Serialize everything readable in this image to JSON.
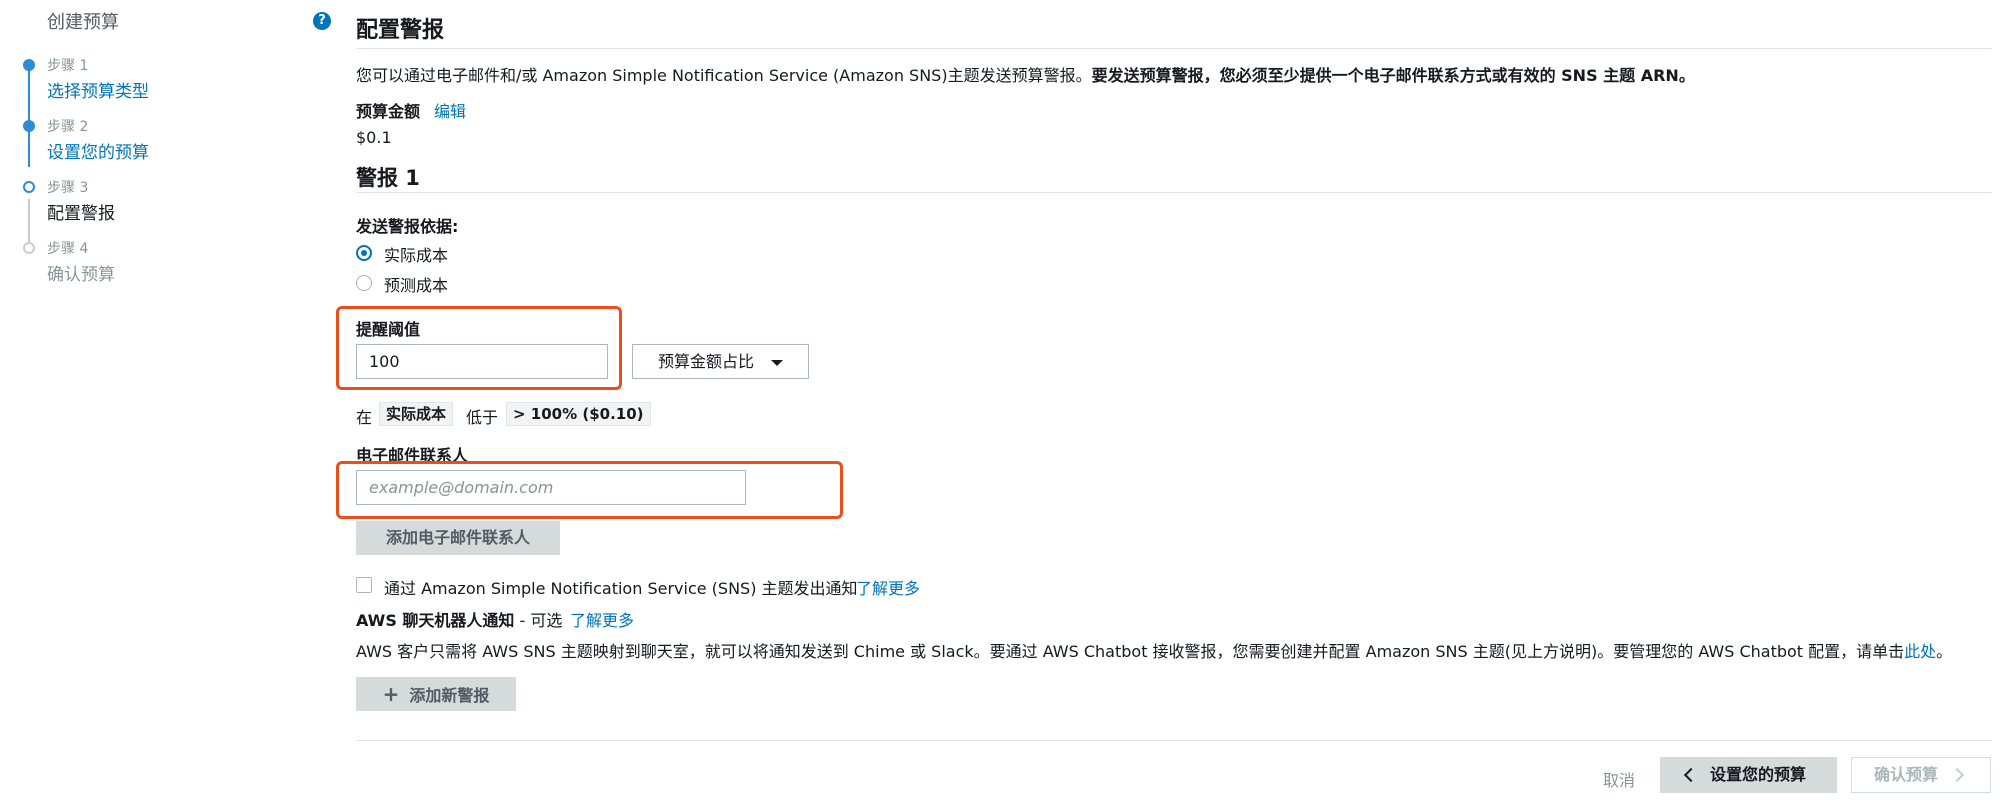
{
  "sidebar": {
    "title": "创建预算",
    "help_icon": "question-circle-icon",
    "steps": [
      {
        "num": "步骤 1",
        "label": "选择预算类型"
      },
      {
        "num": "步骤 2",
        "label": "设置您的预算"
      },
      {
        "num": "步骤 3",
        "label": "配置警报"
      },
      {
        "num": "步骤 4",
        "label": "确认预算"
      }
    ]
  },
  "main": {
    "title": "配置警报",
    "intro_text": "您可以通过电子邮件和/或 Amazon Simple Notification Service (Amazon SNS)主题发送预算警报。",
    "intro_bold": "要发送预算警报，您必须至少提供一个电子邮件联系方式或有效的 SNS 主题 ARN。",
    "budget_amount_label": "预算金额",
    "edit_link": "编辑",
    "budget_amount": "$0.1",
    "alert_title": "警报 1",
    "send_based_on_label": "发送警报依据:",
    "radio_actual": "实际成本",
    "radio_forecast": "预测成本",
    "threshold_label": "提醒阈值",
    "threshold_value": "100",
    "threshold_type": "预算金额占比",
    "condition_prefix": "在",
    "condition_metric": "实际成本",
    "condition_op": "低于",
    "condition_value": "> 100% ($0.10)",
    "email_label": "电子邮件联系人",
    "email_placeholder": "example@domain.com",
    "add_email_button": "添加电子邮件联系人",
    "sns_label": "通过 Amazon Simple Notification Service (SNS) 主题发出通知",
    "learn_more": "了解更多",
    "chatbot_title_bold": "AWS 聊天机器人通知",
    "chatbot_title_rest": " - 可选",
    "chatbot_learn_more": "了解更多",
    "chatbot_desc": "AWS 客户只需将 AWS SNS 主题映射到聊天室，就可以将通知发送到 Chime 或 Slack。要通过 AWS Chatbot 接收警报，您需要创建并配置 Amazon SNS 主题(见上方说明)。要管理您的 AWS Chatbot 配置，请单击",
    "chatbot_here": "此处",
    "chatbot_period": "。",
    "add_alert_button": "添加新警报",
    "cancel": "取消",
    "prev_button": "设置您的预算",
    "next_button": "确认预算"
  },
  "colors": {
    "link": "#0073bb",
    "highlight": "#ea4e1b",
    "button_gray": "#d5dbdb"
  }
}
